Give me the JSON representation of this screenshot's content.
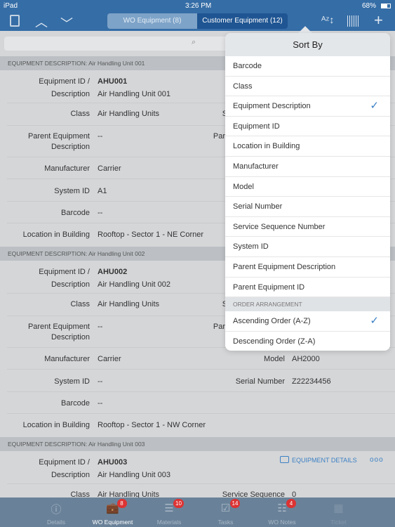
{
  "status": {
    "device": "iPad",
    "time": "3:26 PM",
    "battery": "68%"
  },
  "nav": {
    "tabs": [
      {
        "label": "WO Equipment (8)"
      },
      {
        "label": "Customer Equipment (12)"
      }
    ],
    "icons": [
      "clipboard-icon",
      "chevron-up-icon",
      "chevron-down-icon",
      "sort-az-icon",
      "barcode-icon",
      "plus-icon"
    ]
  },
  "search": {
    "placeholder": ""
  },
  "blocks": [
    {
      "header": "EQUIPMENT DESCRIPTION: Air Handling Unit 001",
      "id_label": "Equipment ID /",
      "desc_label": "Description",
      "id": "AHU001",
      "desc": "Air Handling Unit 001",
      "class_label": "Class",
      "class": "Air Handling Units",
      "svc_label": "Service Sequence",
      "svc": "",
      "parent_label1": "Parent Equipment",
      "parent_label2": "Description",
      "parent": "--",
      "pid_label": "Parent Equipment ID",
      "manufacturer_label": "Manufacturer",
      "manufacturer": "Carrier",
      "model_label": "",
      "model": "",
      "sysid_label": "System ID",
      "sysid": "A1",
      "serial_label": "",
      "serial": "",
      "barcode_label": "Barcode",
      "barcode": "--",
      "loc_label": "Location in Building",
      "loc": "Rooftop - Sector 1 - NE Corner"
    },
    {
      "header": "EQUIPMENT DESCRIPTION: Air Handling Unit 002",
      "id_label": "Equipment ID /",
      "desc_label": "Description",
      "id": "AHU002",
      "desc": "Air Handling Unit 002",
      "class_label": "Class",
      "class": "Air Handling Units",
      "svc_label": "Service Sequence",
      "svc": "",
      "parent_label1": "Parent Equipment",
      "parent_label2": "Description",
      "parent": "--",
      "pid_label": "Parent Equipment ID",
      "manufacturer_label": "Manufacturer",
      "manufacturer": "Carrier",
      "model_label": "Model",
      "model": "AH2000",
      "sysid_label": "System ID",
      "sysid": "--",
      "serial_label": "Serial Number",
      "serial": "Z22234456",
      "barcode_label": "Barcode",
      "barcode": "--",
      "loc_label": "Location in Building",
      "loc": "Rooftop - Sector 1 - NW Corner"
    },
    {
      "header": "EQUIPMENT DESCRIPTION: Air Handling Unit 003",
      "id_label": "Equipment ID /",
      "desc_label": "Description",
      "id": "AHU003",
      "desc": "Air Handling Unit 003",
      "class_label": "Class",
      "class": "Air Handling Units",
      "svc_label": "Service Sequence",
      "svc": "0",
      "details_label": "EQUIPMENT DETAILS",
      "more": "ooo"
    }
  ],
  "sort": {
    "title": "Sort By",
    "items": [
      "Barcode",
      "Class",
      "Equipment Description",
      "Equipment ID",
      "Location in Building",
      "Manufacturer",
      "Model",
      "Serial Number",
      "Service Sequence Number",
      "System ID",
      "Parent Equipment Description",
      "Parent Equipment ID"
    ],
    "selected": "Equipment Description",
    "order_header": "ORDER ARRANGEMENT",
    "orders": [
      "Ascending Order (A-Z)",
      "Descending Order (Z-A)"
    ],
    "selected_order": "Ascending Order (A-Z)",
    "accent": "#3b80c4"
  },
  "tabbar": [
    {
      "label": "Details",
      "icon": "info-icon",
      "badge": ""
    },
    {
      "label": "WO Equipment",
      "icon": "briefcase-icon",
      "badge": "8"
    },
    {
      "label": "Materials",
      "icon": "list-icon",
      "badge": "10"
    },
    {
      "label": "Tasks",
      "icon": "clipboard-check-icon",
      "badge": "14"
    },
    {
      "label": "WO Notes",
      "icon": "notes-icon",
      "badge": "4"
    },
    {
      "label": "Ticket",
      "icon": "ticket-icon",
      "badge": ""
    }
  ]
}
